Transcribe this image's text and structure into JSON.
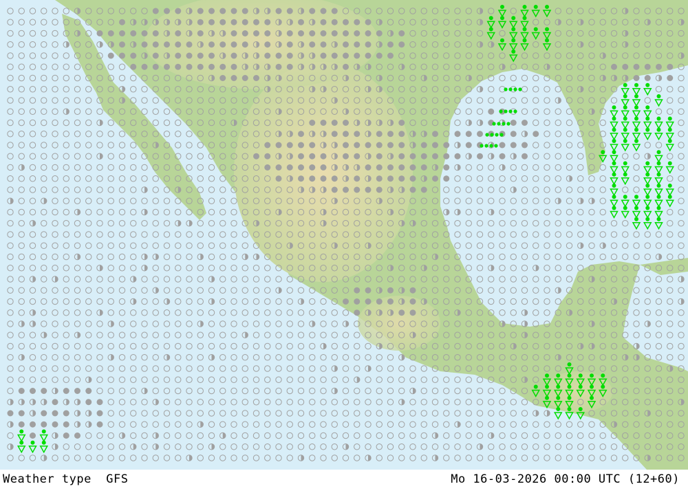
{
  "footer": {
    "title": "Weather type  GFS",
    "timestamp": "Mo 16-03-2026 00:00 UTC (12+60)"
  },
  "colors": {
    "ocean": "#d8eef8",
    "land_low": "#a8cf8c",
    "land_high": "#e8ddb0",
    "dry_marker": "#a0a0a0",
    "rain_marker": "#00dd00"
  },
  "legend_symbols": {
    "empty_circle": "no precipitation",
    "filled_circle": "cloud cover marker",
    "green_triangle": "shower-icon",
    "green_dots": "rain-icon"
  }
}
